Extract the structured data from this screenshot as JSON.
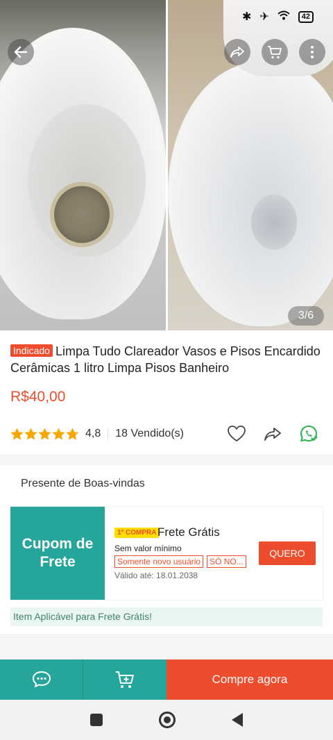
{
  "status_bar": {
    "battery": "42"
  },
  "gallery": {
    "page_counter": "3/6"
  },
  "product": {
    "badge": "Indicado",
    "title": "Limpa Tudo Clareador Vasos e Pisos Encardido Cerâmicas 1 litro Limpa Pisos Banheiro",
    "price": "R$40,00",
    "rating": "4,8",
    "rating_value": 4.8,
    "rating_max": 5,
    "sold": "18 Vendido(s)"
  },
  "voucher": {
    "heading": "Presente de Boas-vindas",
    "left_label": "Cupom de Frete",
    "first_badge": "1ª COMPRA",
    "title": "Frete Grátis",
    "min_value": "Sem valor mínimo",
    "tags": [
      "Somente novo usuário",
      "SÓ NO..."
    ],
    "valid": "Válido até: 18.01.2038",
    "button": "QUERO",
    "note": "Item Aplicável para Frete Grátis!"
  },
  "action_bar": {
    "buy_label": "Compre agora"
  },
  "icons": {
    "back": "arrow-left-icon",
    "share": "share-icon",
    "cart": "cart-icon",
    "more": "more-vertical-icon",
    "heart": "heart-icon",
    "whatsapp": "whatsapp-icon",
    "chat": "chat-icon",
    "add_cart": "add-to-cart-icon"
  },
  "colors": {
    "accent": "#ee4d2d",
    "teal": "#26a69a",
    "star": "#f6a700"
  }
}
